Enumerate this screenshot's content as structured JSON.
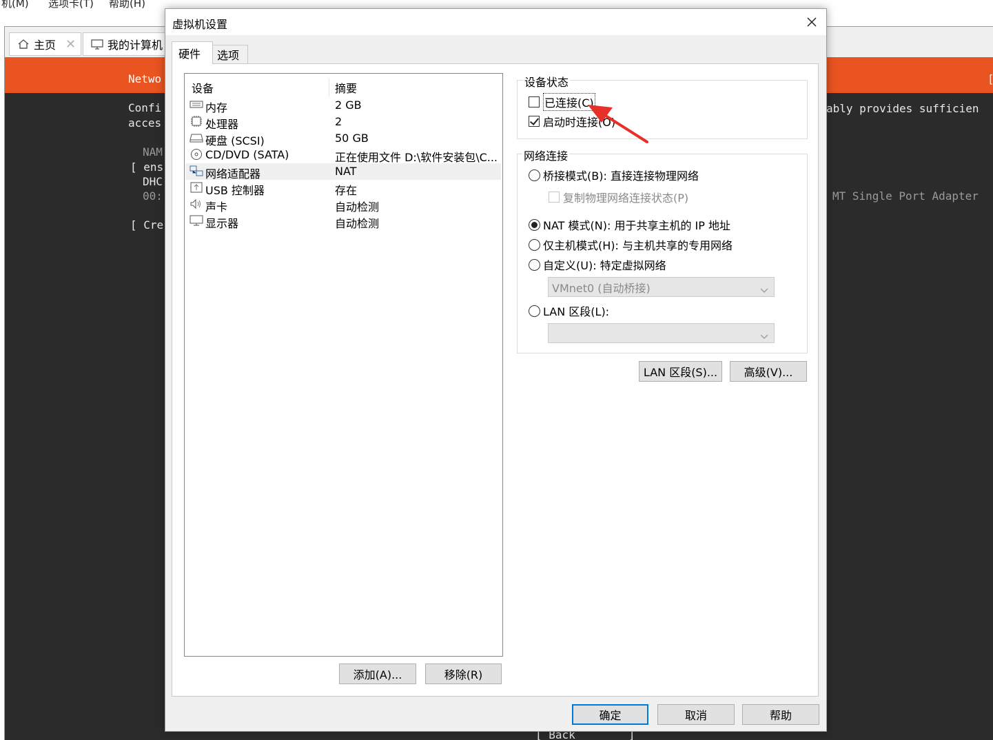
{
  "app": {
    "menu": [
      "机(M)",
      "选项卡(T)",
      "帮助(H)"
    ],
    "tabs": [
      {
        "label": "主页",
        "icon": "home-icon",
        "close": "✕"
      },
      {
        "label": "我的计算机",
        "icon": "computer-icon"
      }
    ]
  },
  "vm_screen": {
    "header_left": "Netwo",
    "header_right": "[",
    "lines_left": [
      "Confi",
      "acces",
      "NAM",
      "[ ens",
      "DHC",
      "00:",
      "[ Cre"
    ],
    "lines_right": [
      "ably provides sufficien",
      "MT Single Port Adapter"
    ],
    "bottom": "[ Back        ]"
  },
  "dialog": {
    "title": "虚拟机设置",
    "close_icon": "close-icon",
    "tabs": {
      "hardware": "硬件",
      "options": "选项"
    },
    "device_list": {
      "headers": {
        "device": "设备",
        "summary": "摘要"
      },
      "rows": [
        {
          "name": "内存",
          "summary": "2 GB",
          "icon": "memory-icon"
        },
        {
          "name": "处理器",
          "summary": "2",
          "icon": "cpu-icon"
        },
        {
          "name": "硬盘 (SCSI)",
          "summary": "50 GB",
          "icon": "hard-disk-icon"
        },
        {
          "name": "CD/DVD (SATA)",
          "summary": "正在使用文件 D:\\软件安装包\\C...",
          "icon": "cd-dvd-icon"
        },
        {
          "name": "网络适配器",
          "summary": "NAT",
          "icon": "network-adapter-icon",
          "selected": true
        },
        {
          "name": "USB 控制器",
          "summary": "存在",
          "icon": "usb-icon"
        },
        {
          "name": "声卡",
          "summary": "自动检测",
          "icon": "sound-icon"
        },
        {
          "name": "显示器",
          "summary": "自动检测",
          "icon": "display-icon"
        }
      ]
    },
    "buttons": {
      "add": "添加(A)...",
      "remove": "移除(R)",
      "lan_segments": "LAN 区段(S)...",
      "advanced": "高级(V)...",
      "ok": "确定",
      "cancel": "取消",
      "help": "帮助"
    },
    "device_status": {
      "title": "设备状态",
      "connected": {
        "label": "已连接(C)",
        "checked": false
      },
      "connect_at_power_on": {
        "label": "启动时连接(O)",
        "checked": true
      }
    },
    "network_connection": {
      "title": "网络连接",
      "bridged": "桥接模式(B): 直接连接物理网络",
      "replicate": "复制物理网络连接状态(P)",
      "nat": "NAT 模式(N): 用于共享主机的 IP 地址",
      "host_only": "仅主机模式(H): 与主机共享的专用网络",
      "custom": "自定义(U): 特定虚拟网络",
      "custom_value": "VMnet0 (自动桥接)",
      "lan_segment": "LAN 区段(L):",
      "lan_segment_value": "",
      "selected": "nat"
    },
    "annotation_color": "#e8302a"
  }
}
